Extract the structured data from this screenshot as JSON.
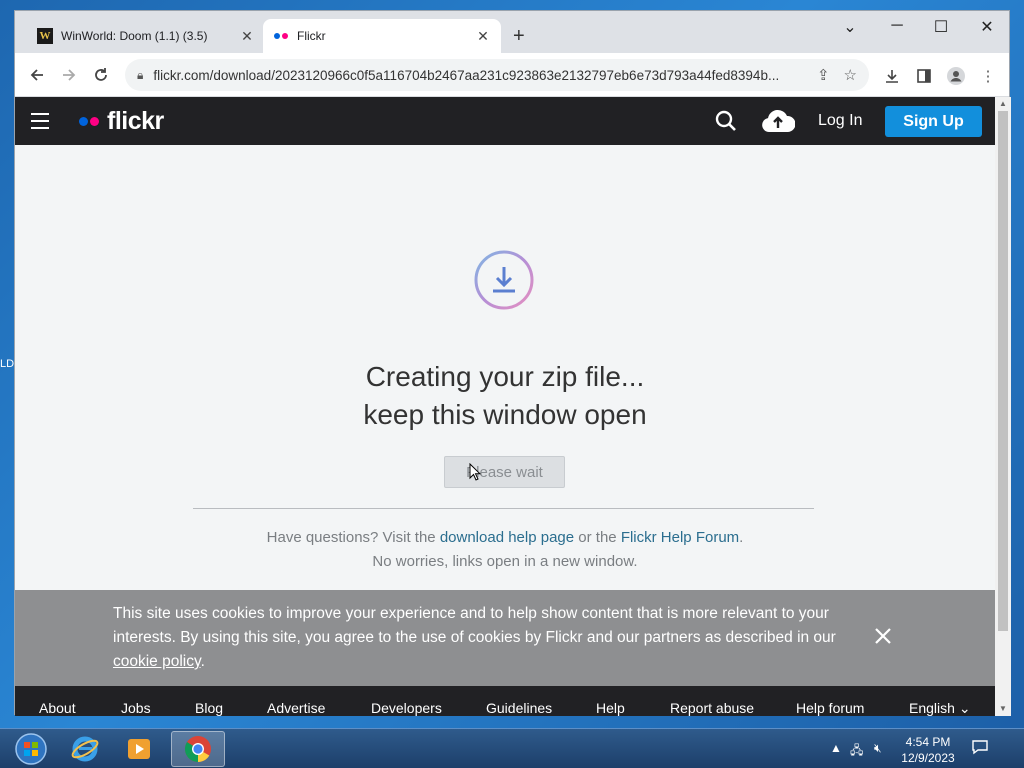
{
  "browser": {
    "tabs": [
      {
        "title": "WinWorld: Doom (1.1) (3.5)",
        "favicon": "winworld-favicon"
      },
      {
        "title": "Flickr",
        "favicon": "flickr-favicon"
      }
    ],
    "url": "flickr.com/download/2023120966c0f5a116704b2467aa231c923863e2132797eb6e73d793a44fed8394b..."
  },
  "header": {
    "logo_text": "flickr",
    "login_label": "Log In",
    "signup_label": "Sign Up"
  },
  "main": {
    "heading_line1": "Creating your zip file...",
    "heading_line2": "keep this window open",
    "wait_button_label": "Please wait",
    "help_prefix": "Have questions? Visit the",
    "help_link1": "download help page",
    "help_middle": "or the",
    "help_link2": "Flickr Help Forum",
    "help_suffix": ".",
    "help_line2": "No worries, links open in a new window."
  },
  "cookie": {
    "text": "This site uses cookies to improve your experience and to help show content that is more relevant to your interests. By using this site, you agree to the use of cookies by Flickr and our partners as described in our",
    "link": "cookie policy",
    "suffix": "."
  },
  "footer": {
    "links": [
      "About",
      "Jobs",
      "Blog",
      "Advertise",
      "Developers",
      "Guidelines",
      "Help",
      "Report abuse",
      "Help forum",
      "English"
    ]
  },
  "taskbar": {
    "time": "4:54 PM",
    "date": "12/9/2023",
    "apps": [
      "start-orb",
      "internet-explorer",
      "media-player",
      "chrome"
    ]
  },
  "colors": {
    "flickr_blue": "#0063dc",
    "flickr_pink": "#ff0084",
    "signup_button": "#128fdc",
    "header_bg": "#212124",
    "link": "#2b6e8f"
  }
}
